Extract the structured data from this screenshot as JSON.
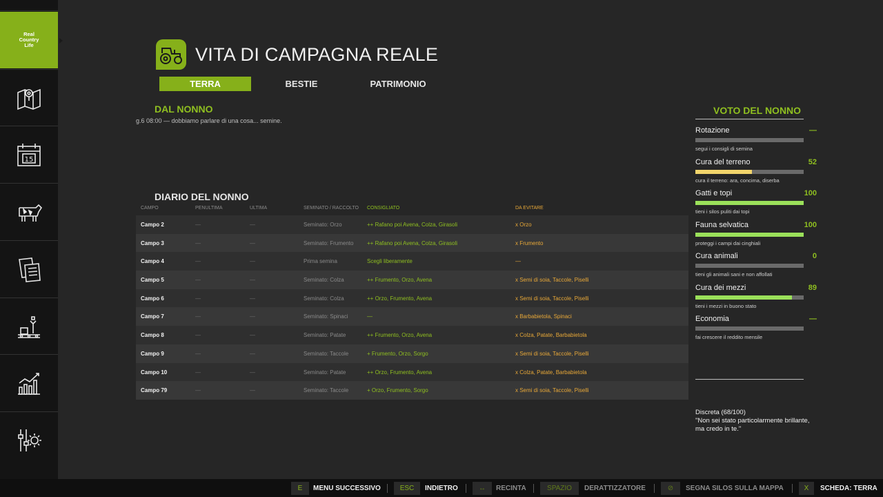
{
  "app": {
    "logo_text": "Real Country Life"
  },
  "header": {
    "title": "VITA DI CAMPAGNA REALE"
  },
  "tabs": [
    {
      "label": "TERRA",
      "active": true
    },
    {
      "label": "BESTIE",
      "active": false
    },
    {
      "label": "PATRIMONIO",
      "active": false
    }
  ],
  "dal_nonno": {
    "title": "DAL NONNO",
    "message": "g.6  08:00  —  dobbiamo parlare di una cosa... semine."
  },
  "diario": {
    "title": "DIARIO DEL NONNO",
    "columns": [
      "CAMPO",
      "PENULTIMA",
      "ULTIMA",
      "SEMINATO / RACCOLTO",
      "CONSIGLIATO",
      "DA EVITARE"
    ],
    "rows": [
      {
        "campo": "Campo 2",
        "penultima": "—",
        "ultima": "—",
        "seminato": "Seminato: Orzo",
        "consigliato": "++ Rafano poi Avena, Colza, Girasoli",
        "evitare": "x Orzo"
      },
      {
        "campo": "Campo 3",
        "penultima": "—",
        "ultima": "—",
        "seminato": "Seminato: Frumento",
        "consigliato": "++ Rafano poi Avena, Colza, Girasoli",
        "evitare": "x Frumento"
      },
      {
        "campo": "Campo 4",
        "penultima": "—",
        "ultima": "—",
        "seminato": "Prima semina",
        "consigliato": "Scegli liberamente",
        "evitare": "—"
      },
      {
        "campo": "Campo 5",
        "penultima": "—",
        "ultima": "—",
        "seminato": "Seminato: Colza",
        "consigliato": "++ Frumento, Orzo, Avena",
        "evitare": "x Semi di soia, Taccole, Piselli"
      },
      {
        "campo": "Campo 6",
        "penultima": "—",
        "ultima": "—",
        "seminato": "Seminato: Colza",
        "consigliato": "++ Orzo, Frumento, Avena",
        "evitare": "x Semi di soia, Taccole, Piselli"
      },
      {
        "campo": "Campo 7",
        "penultima": "—",
        "ultima": "—",
        "seminato": "Seminato: Spinaci",
        "consigliato": "—",
        "evitare": "x Barbabietola, Spinaci"
      },
      {
        "campo": "Campo 8",
        "penultima": "—",
        "ultima": "—",
        "seminato": "Seminato: Patate",
        "consigliato": "++ Frumento, Orzo, Avena",
        "evitare": "x Colza, Patate, Barbabietola"
      },
      {
        "campo": "Campo 9",
        "penultima": "—",
        "ultima": "—",
        "seminato": "Seminato: Taccole",
        "consigliato": "+ Frumento, Orzo, Sorgo",
        "evitare": "x Semi di soia, Taccole, Piselli"
      },
      {
        "campo": "Campo 10",
        "penultima": "—",
        "ultima": "—",
        "seminato": "Seminato: Patate",
        "consigliato": "++ Orzo, Frumento, Avena",
        "evitare": "x Colza, Patate, Barbabietola"
      },
      {
        "campo": "Campo 79",
        "penultima": "—",
        "ultima": "—",
        "seminato": "Seminato: Taccole",
        "consigliato": "+ Orzo, Frumento, Sorgo",
        "evitare": "x Semi di soia, Taccole, Piselli"
      }
    ]
  },
  "voto": {
    "title": "VOTO DEL NONNO",
    "metrics": [
      {
        "name": "Rotazione",
        "value": "—",
        "fill": 0,
        "color": "#9be05a",
        "desc": "segui i consigli di semina"
      },
      {
        "name": "Cura del terreno",
        "value": "52",
        "fill": 0.52,
        "color": "#f2d56b",
        "desc": "cura il terreno: ara, concima, diserba"
      },
      {
        "name": "Gatti e topi",
        "value": "100",
        "fill": 1.0,
        "color": "#9be05a",
        "desc": "tieni i silos puliti dai topi"
      },
      {
        "name": "Fauna selvatica",
        "value": "100",
        "fill": 1.0,
        "color": "#9be05a",
        "desc": "proteggi i campi dai cinghiali"
      },
      {
        "name": "Cura animali",
        "value": "0",
        "fill": 0,
        "color": "#9be05a",
        "desc": "tieni gli animali sani e non affollati"
      },
      {
        "name": "Cura dei mezzi",
        "value": "89",
        "fill": 0.89,
        "color": "#9be05a",
        "desc": "tieni i mezzi in buono stato"
      },
      {
        "name": "Economia",
        "value": "—",
        "fill": 0,
        "color": "#9be05a",
        "desc": "fai crescere il reddito mensile"
      }
    ],
    "verdict_line1": "Discreta (68/100)",
    "verdict_line2": "\"Non sei stato particolarmente brillante, ma credo in te.\""
  },
  "footer": {
    "items": [
      {
        "key": "E",
        "label": "MENU SUCCESSIVO",
        "dim": false
      },
      {
        "key": "ESC",
        "label": "INDIETRO",
        "dim": false
      },
      {
        "key": "↔",
        "label": "RECINTA",
        "dim": true
      },
      {
        "key": "SPAZIO",
        "label": "DERATTIZZATORE",
        "dim": true
      },
      {
        "key": "⊘",
        "label": "SEGNA SILOS SULLA MAPPA",
        "dim": true
      },
      {
        "key": "X",
        "label": "SCHEDA: TERRA",
        "dim": false
      }
    ]
  },
  "colors": {
    "accent": "#86b01a",
    "accent_text": "#8fbf20",
    "warning": "#e8a838"
  }
}
